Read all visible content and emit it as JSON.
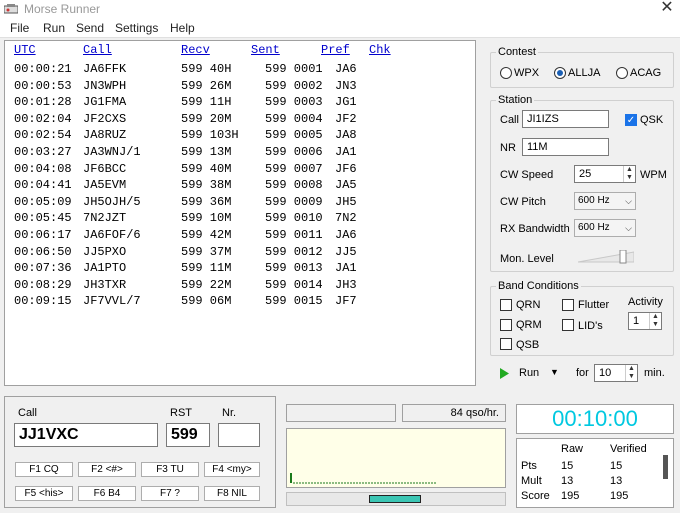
{
  "window": {
    "title": "Morse Runner",
    "close": "✕"
  },
  "menu": [
    "File",
    "Run",
    "Send",
    "Settings",
    "Help"
  ],
  "log": {
    "headers": {
      "utc": "UTC",
      "call": "Call",
      "recv": "Recv",
      "sent": "Sent",
      "pref": "Pref",
      "chk": "Chk"
    },
    "rows": [
      [
        "00:00:21",
        "JA6FFK",
        "599 40H",
        "599 0001",
        "JA6"
      ],
      [
        "00:00:53",
        "JN3WPH",
        "599 26M",
        "599 0002",
        "JN3"
      ],
      [
        "00:01:28",
        "JG1FMA",
        "599 11H",
        "599 0003",
        "JG1"
      ],
      [
        "00:02:04",
        "JF2CXS",
        "599 20M",
        "599 0004",
        "JF2"
      ],
      [
        "00:02:54",
        "JA8RUZ",
        "599 103H",
        "599 0005",
        "JA8"
      ],
      [
        "00:03:27",
        "JA3WNJ/1",
        "599 13M",
        "599 0006",
        "JA1"
      ],
      [
        "00:04:08",
        "JF6BCC",
        "599 40M",
        "599 0007",
        "JF6"
      ],
      [
        "00:04:41",
        "JA5EVM",
        "599 38M",
        "599 0008",
        "JA5"
      ],
      [
        "00:05:09",
        "JH5OJH/5",
        "599 36M",
        "599 0009",
        "JH5"
      ],
      [
        "00:05:45",
        "7N2JZT",
        "599 10M",
        "599 0010",
        "7N2"
      ],
      [
        "00:06:17",
        "JA6FOF/6",
        "599 42M",
        "599 0011",
        "JA6"
      ],
      [
        "00:06:50",
        "JJ5PXO",
        "599 37M",
        "599 0012",
        "JJ5"
      ],
      [
        "00:07:36",
        "JA1PTO",
        "599 11M",
        "599 0013",
        "JA1"
      ],
      [
        "00:08:29",
        "JH3TXR",
        "599 22M",
        "599 0014",
        "JH3"
      ],
      [
        "00:09:15",
        "JF7VVL/7",
        "599 06M",
        "599 0015",
        "JF7"
      ]
    ]
  },
  "contest": {
    "label": "Contest",
    "options": [
      "WPX",
      "ALLJA",
      "ACAG"
    ],
    "selected": "ALLJA"
  },
  "station": {
    "label": "Station",
    "call_label": "Call",
    "call_value": "JI1IZS",
    "qsk_label": "QSK",
    "nr_label": "NR",
    "nr_value": "11M",
    "cw_speed_label": "CW Speed",
    "cw_speed_value": "25",
    "wpm_label": "WPM",
    "cw_pitch_label": "CW Pitch",
    "cw_pitch_value": "600 Hz",
    "rx_bw_label": "RX Bandwidth",
    "rx_bw_value": "600 Hz",
    "mon_level_label": "Mon. Level"
  },
  "band": {
    "label": "Band Conditions",
    "qrn": "QRN",
    "qrm": "QRM",
    "qsb": "QSB",
    "flutter": "Flutter",
    "lids": "LID's",
    "activity_label": "Activity",
    "activity_value": "1"
  },
  "run": {
    "label": "Run",
    "for_label": "for",
    "minutes": "10",
    "min_label": "min."
  },
  "entry": {
    "call_label": "Call",
    "call_value": "JJ1VXC",
    "rst_label": "RST",
    "rst_value": "599",
    "nr_label": "Nr.",
    "nr_value": ""
  },
  "fkeys": [
    "F1 CQ",
    "F2 <#>",
    "F3 TU",
    "F4 <my>",
    "F5 <his>",
    "F6 B4",
    "F7 ?",
    "F8 NIL"
  ],
  "rate": "84 qso/hr.",
  "clock": "00:10:00",
  "score": {
    "headers": [
      "",
      "Raw",
      "Verified"
    ],
    "rows": [
      [
        "Pts",
        "15",
        "15"
      ],
      [
        "Mult",
        "13",
        "13"
      ],
      [
        "Score",
        "195",
        "195"
      ]
    ]
  },
  "colors": {
    "clock": "#00c8e0",
    "link": "#0000cc",
    "accent": "#1a73e8"
  }
}
